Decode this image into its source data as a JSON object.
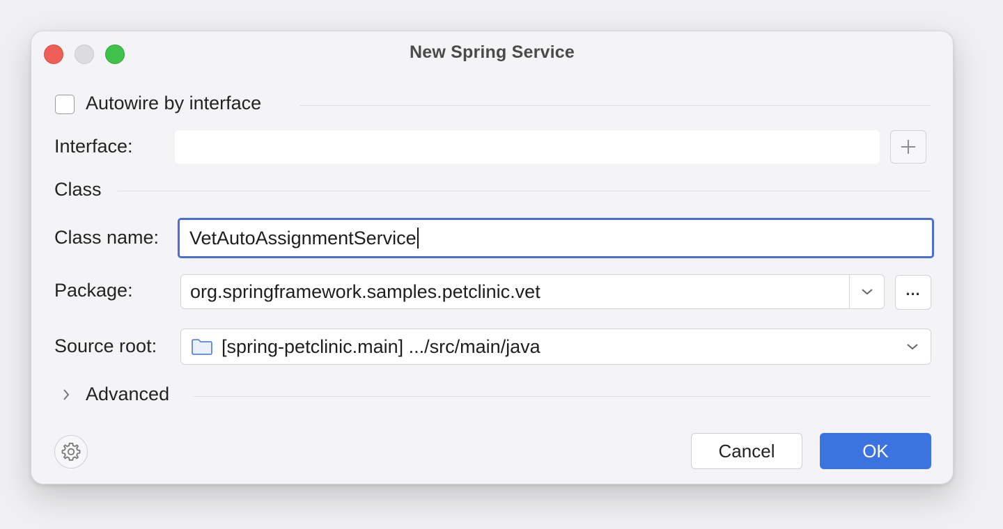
{
  "window": {
    "title": "New Spring Service"
  },
  "autowire": {
    "label": "Autowire by interface",
    "checked": false
  },
  "interface": {
    "label": "Interface:",
    "value": ""
  },
  "class_section": {
    "label": "Class"
  },
  "class_name": {
    "label": "Class name:",
    "value": "VetAutoAssignmentService"
  },
  "package": {
    "label": "Package:",
    "value": "org.springframework.samples.petclinic.vet",
    "browse_label": "..."
  },
  "source_root": {
    "label": "Source root:",
    "value": "[spring-petclinic.main] .../src/main/java"
  },
  "advanced": {
    "label": "Advanced",
    "expanded": false
  },
  "buttons": {
    "cancel": "Cancel",
    "ok": "OK"
  },
  "colors": {
    "accent": "#3b74e0",
    "focus_ring": "#4a6fd3",
    "close": "#ee5f58",
    "maximize": "#3fc24a"
  }
}
